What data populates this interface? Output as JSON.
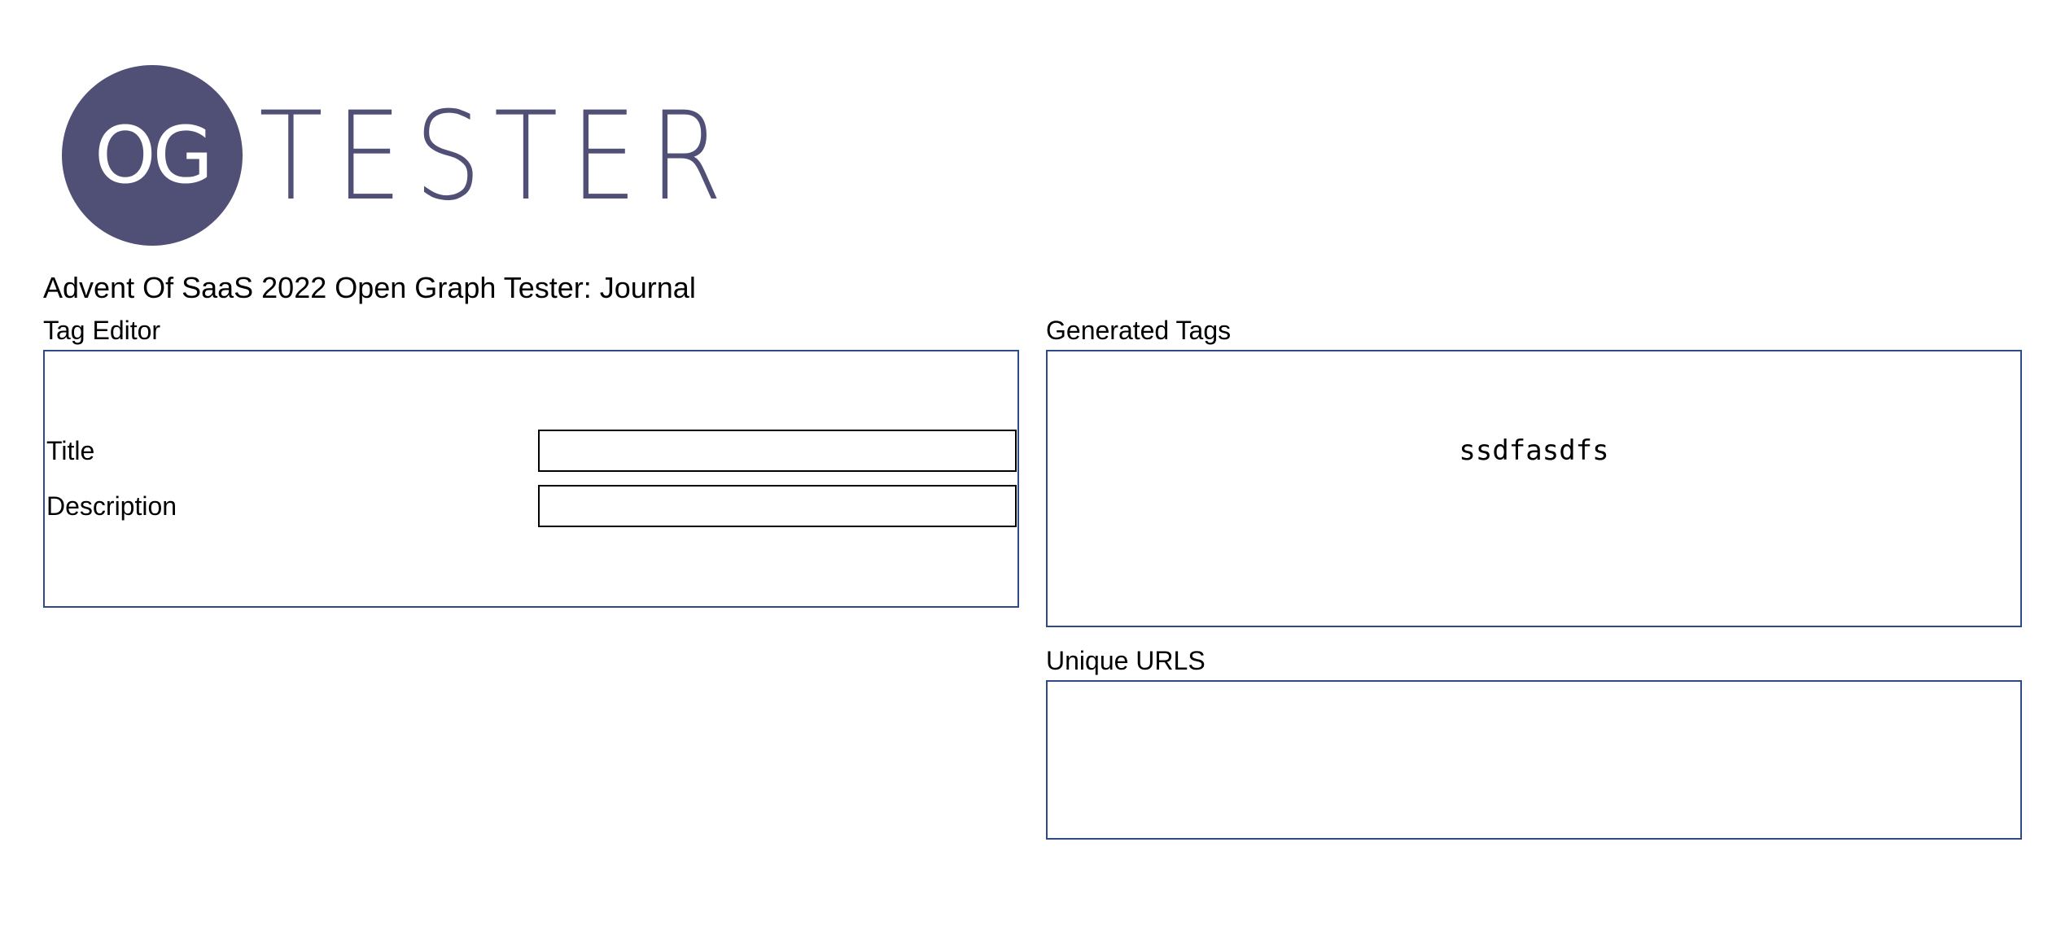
{
  "logo": {
    "badge_text": "OG",
    "wordmark": "TESTER",
    "brand_color": "#504f76"
  },
  "header": {
    "title": "Advent Of SaaS 2022 Open Graph Tester: Journal"
  },
  "tag_editor": {
    "label": "Tag Editor",
    "fields": [
      {
        "label": "Title",
        "value": "",
        "placeholder": ""
      },
      {
        "label": "Description",
        "value": "",
        "placeholder": ""
      }
    ]
  },
  "generated_tags": {
    "label": "Generated Tags",
    "content": "ssdfasdfs"
  },
  "unique_urls": {
    "label": "Unique URLS",
    "content": ""
  },
  "colors": {
    "panel_border": "#2e4a8b",
    "input_border": "#000000",
    "background": "#ffffff"
  }
}
